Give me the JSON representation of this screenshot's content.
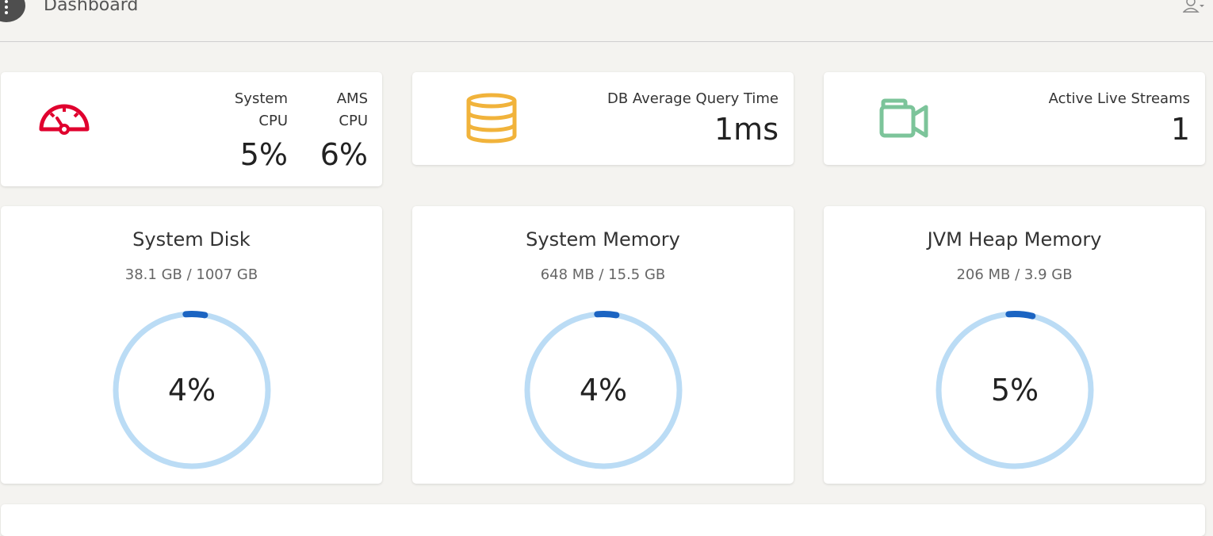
{
  "header": {
    "title": "Dashboard",
    "menu_icon": "more-vertical-icon",
    "user_icon": "user-dropdown-icon"
  },
  "cpu_card": {
    "icon": "speedometer-icon",
    "icon_color": "#e0002e",
    "system_label_line1": "System",
    "system_label_line2": "CPU",
    "system_value": "5%",
    "ams_label_line1": "AMS",
    "ams_label_line2": "CPU",
    "ams_value": "6%"
  },
  "db_card": {
    "icon": "database-icon",
    "icon_color": "#f1b33b",
    "label": "DB Average Query Time",
    "value": "1ms"
  },
  "streams_card": {
    "icon": "video-camera-icon",
    "icon_color": "#7cc49a",
    "label": "Active Live Streams",
    "value": "1"
  },
  "resources": [
    {
      "title": "System Disk",
      "usage": "38.1 GB / 1007 GB",
      "percent_label": "4%",
      "percent": 4
    },
    {
      "title": "System Memory",
      "usage": "648 MB / 15.5 GB",
      "percent_label": "4%",
      "percent": 4
    },
    {
      "title": "JVM Heap Memory",
      "usage": "206 MB / 3.9 GB",
      "percent_label": "5%",
      "percent": 5
    }
  ],
  "colors": {
    "gauge_track": "#bbdcf5",
    "gauge_fill": "#1b64c2"
  }
}
